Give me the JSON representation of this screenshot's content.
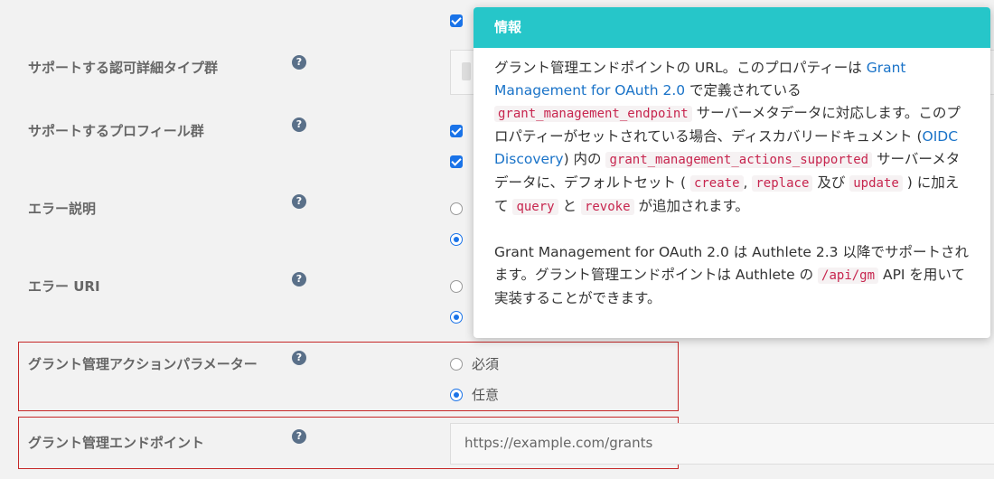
{
  "rows": {
    "authz_detail_types": {
      "label": "サポートする認可詳細タイプ群"
    },
    "profiles": {
      "label": "サポートするプロフィール群"
    },
    "error_description": {
      "label": "エラー説明"
    },
    "error_uri": {
      "label": "エラー URI"
    },
    "grant_mgmt_action": {
      "label": "グラント管理アクションパラメーター",
      "options": [
        "必須",
        "任意"
      ],
      "selected": "任意"
    },
    "grant_mgmt_endpoint": {
      "label": "グラント管理エンドポイント",
      "value": "https://example.com/grants"
    }
  },
  "help_icon_glyph": "?",
  "popover": {
    "title": "情報",
    "p1": {
      "t1": "グラント管理エンドポイントの URL。このプロパティーは ",
      "link1": "Grant Management for OAuth 2.0",
      "t2": " で定義されている ",
      "code1": "grant_management_endpoint",
      "t3": " サーバーメタデータに対応します。このプロパティーがセットされている場合、ディスカバリードキュメント (",
      "link2": "OIDC Discovery",
      "t4": ") 内の ",
      "code2": "grant_management_actions_supported",
      "t5": " サーバーメタデータに、デフォルトセット ( ",
      "code3": "create",
      "t6": ", ",
      "code4": "replace",
      "t7": " 及び ",
      "code5": "update",
      "t8": " ) に加えて ",
      "code6": "query",
      "t9": " と ",
      "code7": "revoke",
      "t10": " が追加されます。"
    },
    "p2": {
      "t1": "Grant Management for OAuth 2.0 は Authlete 2.3 以降でサポートされます。グラント管理エンドポイントは Authlete の ",
      "code1": "/api/gm",
      "t2": " API を用いて実装することができます。"
    }
  },
  "colors": {
    "accent": "#1a73e8",
    "popover_header": "#26c6c9",
    "highlight": "#c62828",
    "code": "#c7254e"
  }
}
